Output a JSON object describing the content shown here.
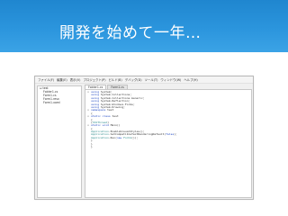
{
  "slide": {
    "title": "開発を始めて一年…"
  },
  "menubar": {
    "items": [
      "ファイル(F)",
      "編集(E)",
      "表示(V)",
      "プロジェクト(P)",
      "ビルド(B)",
      "デバッグ(D)",
      "ツール(T)",
      "ウィンドウ(W)",
      "ヘルプ(H)"
    ]
  },
  "explorer": {
    "root": "test",
    "children": [
      "Folder1.cs",
      "Form1.cs",
      "Form1.resx",
      "Form1.xaml"
    ]
  },
  "tabs": [
    "Folder1.cs",
    "Form1.cs"
  ],
  "code": {
    "lines": [
      {
        "fold": "⊟",
        "text": "using System;"
      },
      {
        "fold": "",
        "text": "using System.Collections;"
      },
      {
        "fold": "",
        "text": "using System.Collections.Generic;"
      },
      {
        "fold": "",
        "text": "using System.Reflection;"
      },
      {
        "fold": "",
        "text": "using System.Windows.Forms;"
      },
      {
        "fold": "",
        "text": "using System.Drawing;"
      },
      {
        "fold": "⊟",
        "text": "namespace test"
      },
      {
        "fold": "",
        "text": "{"
      },
      {
        "fold": "⊟",
        "text": "    static class test"
      },
      {
        "fold": "",
        "text": "    {"
      },
      {
        "fold": "",
        "text": "        [STAThread]"
      },
      {
        "fold": "⊟",
        "text": "        static void Main()"
      },
      {
        "fold": "",
        "text": "        {"
      },
      {
        "fold": "",
        "text": "            Application.EnableVisualStyles();"
      },
      {
        "fold": "",
        "text": "            Application.SetCompatibleTextRenderingDefault(false);"
      },
      {
        "fold": "",
        "text": "            Application.Run(new Form1());"
      },
      {
        "fold": "",
        "text": "        }"
      },
      {
        "fold": "",
        "text": "    }"
      },
      {
        "fold": "",
        "text": "}"
      }
    ]
  },
  "colors": {
    "header_blue": "#2b95dd",
    "keyword": "#1a44c2",
    "type": "#2a8a8a"
  }
}
